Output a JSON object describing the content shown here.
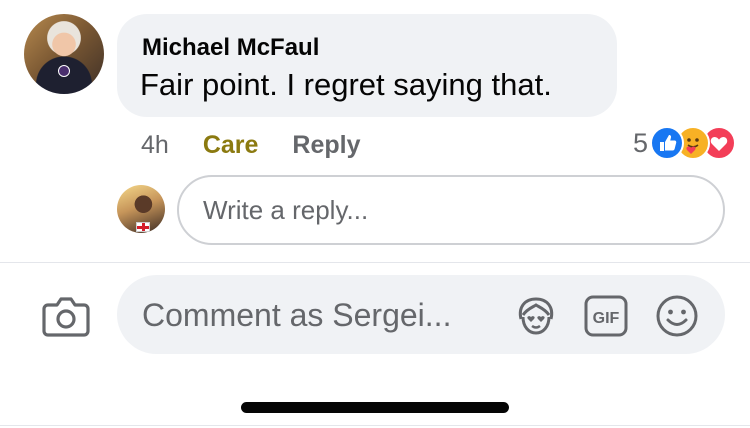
{
  "comment": {
    "author": "Michael McFaul",
    "text": "Fair point. I regret saying that.",
    "time": "4h",
    "reaction_label": "Care",
    "reply_label": "Reply",
    "reaction_count": "5",
    "reactions": [
      "like",
      "care",
      "love"
    ]
  },
  "reply_box": {
    "placeholder": "Write a reply..."
  },
  "composer": {
    "placeholder": "Comment as Sergei...",
    "gif_label": "GIF"
  },
  "colors": {
    "bubble": "#f0f2f5",
    "care_reaction_text": "#8b7a10",
    "like_blue": "#1877f2",
    "love_red": "#f33e58",
    "care_yellow": "#f7b125"
  }
}
